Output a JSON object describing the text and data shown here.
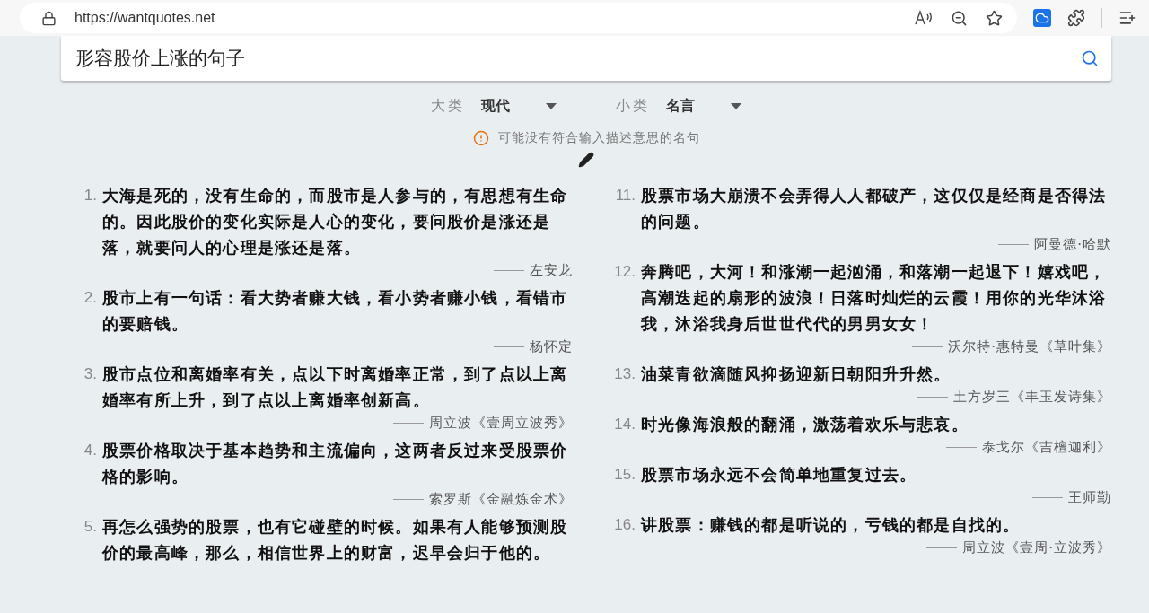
{
  "browser": {
    "url": "https://wantquotes.net"
  },
  "search": {
    "value": "形容股价上涨的句子"
  },
  "filters": [
    {
      "label": "大类",
      "value": "现代"
    },
    {
      "label": "小类",
      "value": "名言"
    }
  ],
  "notice": "可能没有符合输入描述意思的名句",
  "columns": [
    [
      {
        "number": "1.",
        "text": "大海是死的，没有生命的，而股市是人参与的，有思想有生命的。因此股价的变化实际是人心的变化，要问股价是涨还是落，就要问人的心理是涨还是落。",
        "author": "左安龙"
      },
      {
        "number": "2.",
        "text": "股市上有一句话：看大势者赚大钱，看小势者赚小钱，看错市的要赔钱。",
        "author": "杨怀定"
      },
      {
        "number": "3.",
        "text": "股市点位和离婚率有关，点以下时离婚率正常，到了点以上离婚率有所上升，到了点以上离婚率创新高。",
        "author": "周立波《壹周立波秀》"
      },
      {
        "number": "4.",
        "text": "股票价格取决于基本趋势和主流偏向，这两者反过来受股票价格的影响。",
        "author": "索罗斯《金融炼金术》"
      },
      {
        "number": "5.",
        "text": "再怎么强势的股票，也有它碰壁的时候。如果有人能够预测股价的最高峰，那么，相信世界上的财富，迟早会归于他的。"
      }
    ],
    [
      {
        "number": "11.",
        "text": "股票市场大崩溃不会弄得人人都破产，这仅仅是经商是否得法的问题。",
        "author": "阿曼德·哈默"
      },
      {
        "number": "12.",
        "text": "奔腾吧，大河！和涨潮一起汹涌，和落潮一起退下！嬉戏吧，高潮迭起的扇形的波浪！日落时灿烂的云霞！用你的光华沐浴我，沐浴我身后世世代代的男男女女！",
        "author": "沃尔特·惠特曼《草叶集》"
      },
      {
        "number": "13.",
        "text": "油菜青欲滴随风抑扬迎新日朝阳升升然。",
        "author": "土方岁三《丰玉发诗集》"
      },
      {
        "number": "14.",
        "text": "时光像海浪般的翻涌，激荡着欢乐与悲哀。",
        "author": "泰戈尔《吉檀迦利》"
      },
      {
        "number": "15.",
        "text": "股票市场永远不会简单地重复过去。",
        "author": "王师勤"
      },
      {
        "number": "16.",
        "text": "讲股票：赚钱的都是听说的，亏钱的都是自找的。",
        "author": "周立波《壹周·立波秀》"
      }
    ]
  ]
}
